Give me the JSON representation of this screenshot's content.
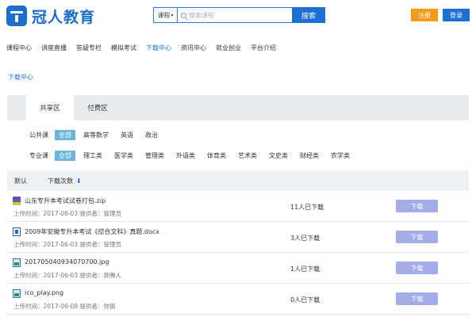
{
  "header": {
    "logo_text": "冠人教育",
    "search_select": "课程",
    "search_placeholder": "搜索课程",
    "search_button": "搜索",
    "register": "注册",
    "login": "登录"
  },
  "nav": [
    "课程中心",
    "讲座直播",
    "答疑专栏",
    "模拟考试",
    "下载中心",
    "资讯中心",
    "就业创业",
    "平台介绍"
  ],
  "nav_active": "下载中心",
  "breadcrumb": "下载中心",
  "tabs": [
    "共享区",
    "付费区"
  ],
  "filters": {
    "public_label": "公共课",
    "public_options": [
      "全部",
      "高等数学",
      "英语",
      "政治"
    ],
    "major_label": "专业课",
    "major_options": [
      "全部",
      "理工类",
      "医学类",
      "管理类",
      "外语类",
      "体育类",
      "艺术类",
      "文史类",
      "财经类",
      "农学类"
    ]
  },
  "sort": {
    "default": "默认",
    "downloads": "下载次数"
  },
  "files": [
    {
      "name": "山东专升本考试试卷打包.zip",
      "meta": "上传时间：2017-06-03 提供者：管理员",
      "count": "11人已下载",
      "button": "下载",
      "icon": "zip-icon"
    },
    {
      "name": "2009年安徽专升本考试《综合文科》真题.docx",
      "meta": "上传时间：2017-06-03 提供者：管理员",
      "count": "3人已下载",
      "button": "下载",
      "icon": "word-doc-icon"
    },
    {
      "name": "201705040934070700.jpg",
      "meta": "上传时间：2017-06-03 提供者：奔腾人",
      "count": "1人已下载",
      "button": "下载",
      "icon": "image-icon"
    },
    {
      "name": "ico_play.png",
      "meta": "上传时间：2017-06-08 提供者：你猜",
      "count": "0人已下载",
      "button": "下载",
      "icon": "image-icon"
    }
  ]
}
